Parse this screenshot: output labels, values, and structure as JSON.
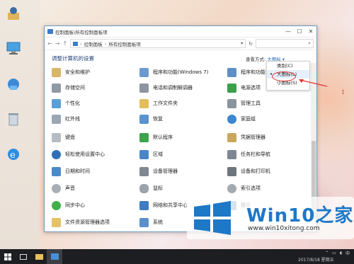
{
  "window": {
    "title": "控制面板\\所有控制面板项",
    "controls": {
      "minimize": "—",
      "maximize": "☐",
      "close": "✕"
    }
  },
  "navbar": {
    "back": "←",
    "forward": "→",
    "up": "↑",
    "path": [
      "控制面板",
      "所有控制面板项"
    ],
    "refresh": "↻"
  },
  "header": {
    "title": "调整计算机的设置",
    "view_by_label": "查看方式:",
    "view_by_value": "大图标 ▾"
  },
  "items": {
    "col1": [
      "安全和维护",
      "存储空间",
      "个性化",
      "红外线",
      "键盘",
      "轻松使用设置中心",
      "日期和时间",
      "声音",
      "同步中心",
      "文件资源管理器选项"
    ],
    "col2": [
      "程序和功能(Windows 7)",
      "电话和调制解调器",
      "工作文件夹",
      "恢复",
      "默认程序",
      "区域",
      "设备管理器",
      "鼠标",
      "网络和共享中心",
      "系统"
    ],
    "col3": [
      "程序和功能",
      "电源选项",
      "管理工具",
      "家庭组",
      "凭据管理器",
      "任务栏和导航",
      "设备和打印机",
      "索引选项",
      "提示"
    ]
  },
  "view_menu": {
    "options": [
      "类别(C)",
      "大图标(L)",
      "小图标(S)"
    ],
    "selected": 1
  },
  "annotation": {
    "number": "1"
  },
  "brand": {
    "name": "Win10之家",
    "url": "www.win10xitong.com"
  },
  "taskbar": {
    "date_partial": "2017/8/18 星期五"
  },
  "colors": {
    "accent": "#1e78c8",
    "title_blue": "#1e3f79",
    "highlight": "#e23333"
  }
}
